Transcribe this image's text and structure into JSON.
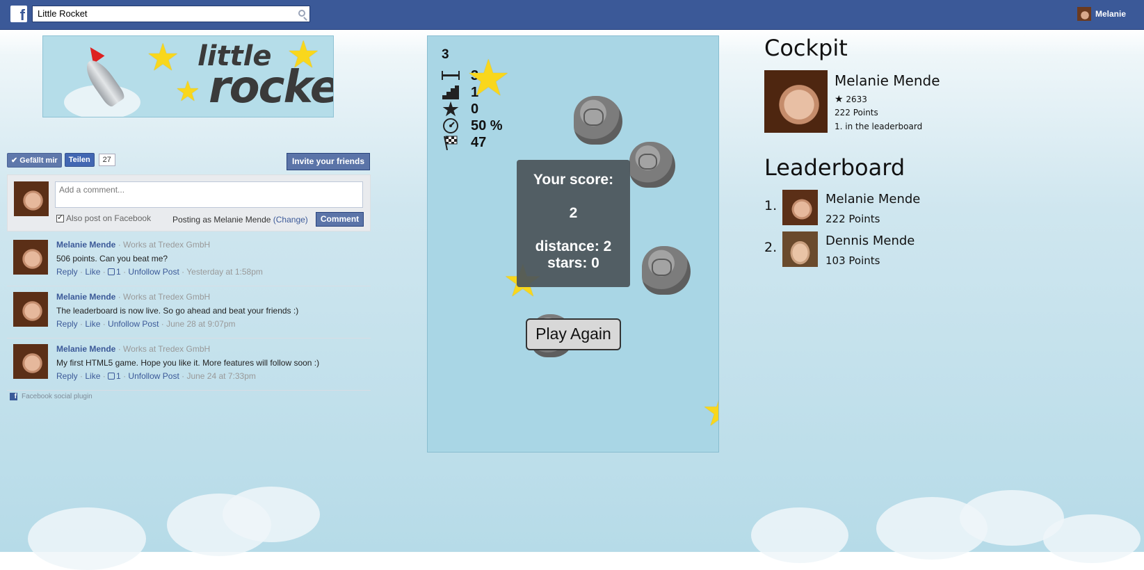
{
  "fb": {
    "search_value": "Little Rocket",
    "user_name": "Melanie"
  },
  "banner": {
    "title_line1": "little",
    "title_line2": "rocket"
  },
  "social": {
    "like_label": "✔ Gefällt mir",
    "share_label": "Teilen",
    "share_count": "27",
    "invite_label": "Invite your friends"
  },
  "comment_box": {
    "placeholder": "Add a comment...",
    "also_post": "Also post on Facebook",
    "posting_as": "Posting as Melanie Mende",
    "change": "(Change)",
    "submit": "Comment"
  },
  "comments": [
    {
      "name": "Melanie Mende",
      "work": "· Works at Tredex GmbH",
      "text": "506 points. Can you beat me?",
      "reply": "Reply",
      "like": "Like",
      "likes": "1",
      "unfollow": "Unfollow Post",
      "time": "· Yesterday at 1:58pm"
    },
    {
      "name": "Melanie Mende",
      "work": "· Works at Tredex GmbH",
      "text": "The leaderboard is now live. So go ahead and beat your friends :)",
      "reply": "Reply",
      "like": "Like",
      "unfollow": "Unfollow Post",
      "time": "· June 28 at 9:07pm"
    },
    {
      "name": "Melanie Mende",
      "work": "· Works at Tredex GmbH",
      "text": "My first HTML5 game. Hope you like it. More features will follow soon :)",
      "reply": "Reply",
      "like": "Like",
      "likes": "1",
      "unfollow": "Unfollow Post",
      "time": "· June 24 at 7:33pm"
    }
  ],
  "plugin_label": "Facebook social plugin",
  "game": {
    "level": "3",
    "hud": {
      "distance": "3",
      "stage": "1",
      "stars": "0",
      "speed": "50 %",
      "goal": "47"
    },
    "score": {
      "label": "Your score:",
      "value": "2",
      "distance": "distance: 2",
      "stars": "stars: 0"
    },
    "play_again": "Play Again"
  },
  "cockpit": {
    "heading": "Cockpit",
    "name": "Melanie Mende",
    "stars": "2633",
    "points": "222 Points",
    "rank": "1. in the leaderboard"
  },
  "leaderboard": {
    "heading": "Leaderboard",
    "entries": [
      {
        "rank": "1.",
        "name": "Melanie Mende",
        "points": "222 Points"
      },
      {
        "rank": "2.",
        "name": "Dennis Mende",
        "points": "103 Points"
      }
    ]
  },
  "colors": {
    "fb_blue": "#3b5998",
    "game_bg": "#a9d6e5",
    "star": "#f9d71c"
  }
}
